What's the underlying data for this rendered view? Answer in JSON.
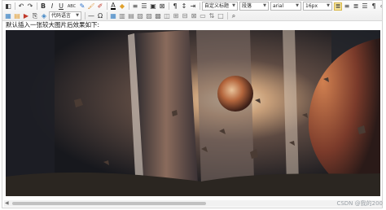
{
  "toolbar": {
    "row1": {
      "buttons_a": [
        {
          "icon": "source-code-icon",
          "glyph": "◧"
        },
        {
          "icon": "undo-icon",
          "glyph": "↶"
        },
        {
          "icon": "redo-icon",
          "glyph": "↷"
        }
      ],
      "buttons_b": [
        {
          "icon": "bold-icon",
          "glyph": "B"
        },
        {
          "icon": "italic-icon",
          "glyph": "I"
        },
        {
          "icon": "underline-icon",
          "glyph": "U"
        },
        {
          "icon": "strikethrough-icon",
          "glyph": "ABC"
        },
        {
          "icon": "eraser-icon",
          "glyph": "✎"
        },
        {
          "icon": "format-painter-icon",
          "glyph": "🖌"
        },
        {
          "icon": "highlight-icon",
          "glyph": "✐"
        }
      ],
      "buttons_c": [
        {
          "icon": "font-color-icon",
          "glyph": "A"
        },
        {
          "icon": "background-color-icon",
          "glyph": "◆"
        }
      ],
      "buttons_d": [
        {
          "icon": "ordered-list-icon",
          "glyph": "≡"
        },
        {
          "icon": "unordered-list-icon",
          "glyph": "☰"
        },
        {
          "icon": "select-all-icon",
          "glyph": "▣"
        },
        {
          "icon": "clear-doc-icon",
          "glyph": "⊠"
        }
      ],
      "buttons_e": [
        {
          "icon": "paragraph-format-icon",
          "glyph": "¶"
        },
        {
          "icon": "line-height-icon",
          "glyph": "↕"
        },
        {
          "icon": "indent-icon",
          "glyph": "⇥"
        }
      ],
      "custom_title_select": "自定义标题",
      "paragraph_select": "段落",
      "font_select": "arial",
      "size_select": "16px",
      "align_buttons": [
        {
          "icon": "align-left-icon",
          "glyph": "≣"
        },
        {
          "icon": "align-center-icon",
          "glyph": "≡"
        },
        {
          "icon": "align-right-icon",
          "glyph": "≣"
        },
        {
          "icon": "align-justify-icon",
          "glyph": "☰"
        }
      ],
      "tail_buttons": [
        {
          "icon": "text-direction-icon",
          "glyph": "¶"
        },
        {
          "icon": "link-icon",
          "glyph": "∞"
        },
        {
          "icon": "fullscreen-icon",
          "glyph": "⤢"
        }
      ]
    },
    "row2": {
      "buttons_a": [
        {
          "icon": "image-icon",
          "glyph": "▦"
        },
        {
          "icon": "multi-image-icon",
          "glyph": "▤"
        },
        {
          "icon": "video-icon",
          "glyph": "▶"
        },
        {
          "icon": "attachment-icon",
          "glyph": "⎘"
        },
        {
          "icon": "map-icon",
          "glyph": "◈"
        }
      ],
      "code_language_select": "代码语言",
      "buttons_b": [
        {
          "icon": "horizontal-rule-icon",
          "glyph": "—"
        },
        {
          "icon": "special-char-icon",
          "glyph": "Ω"
        }
      ],
      "buttons_c": [
        {
          "icon": "table-icon",
          "glyph": "▦"
        },
        {
          "icon": "insert-row-icon",
          "glyph": "▥"
        },
        {
          "icon": "insert-col-icon",
          "glyph": "▤"
        },
        {
          "icon": "delete-row-icon",
          "glyph": "▧"
        },
        {
          "icon": "delete-col-icon",
          "glyph": "▨"
        },
        {
          "icon": "merge-cells-icon",
          "glyph": "▩"
        },
        {
          "icon": "split-cells-icon",
          "glyph": "◫"
        },
        {
          "icon": "table-props-icon",
          "glyph": "⊞"
        },
        {
          "icon": "cell-props-icon",
          "glyph": "⊟"
        },
        {
          "icon": "delete-table-icon",
          "glyph": "⊠"
        },
        {
          "icon": "table-caption-icon",
          "glyph": "▭"
        },
        {
          "icon": "table-sort-icon",
          "glyph": "⇅"
        },
        {
          "icon": "table-border-icon",
          "glyph": "□"
        }
      ],
      "buttons_d": [
        {
          "icon": "search-replace-icon",
          "glyph": "⌕"
        }
      ]
    }
  },
  "content": {
    "intro_text": "默认插入一张较大图片后效果如下:",
    "image_icon": "inserted-image"
  },
  "watermark": "CSDN @我的200"
}
